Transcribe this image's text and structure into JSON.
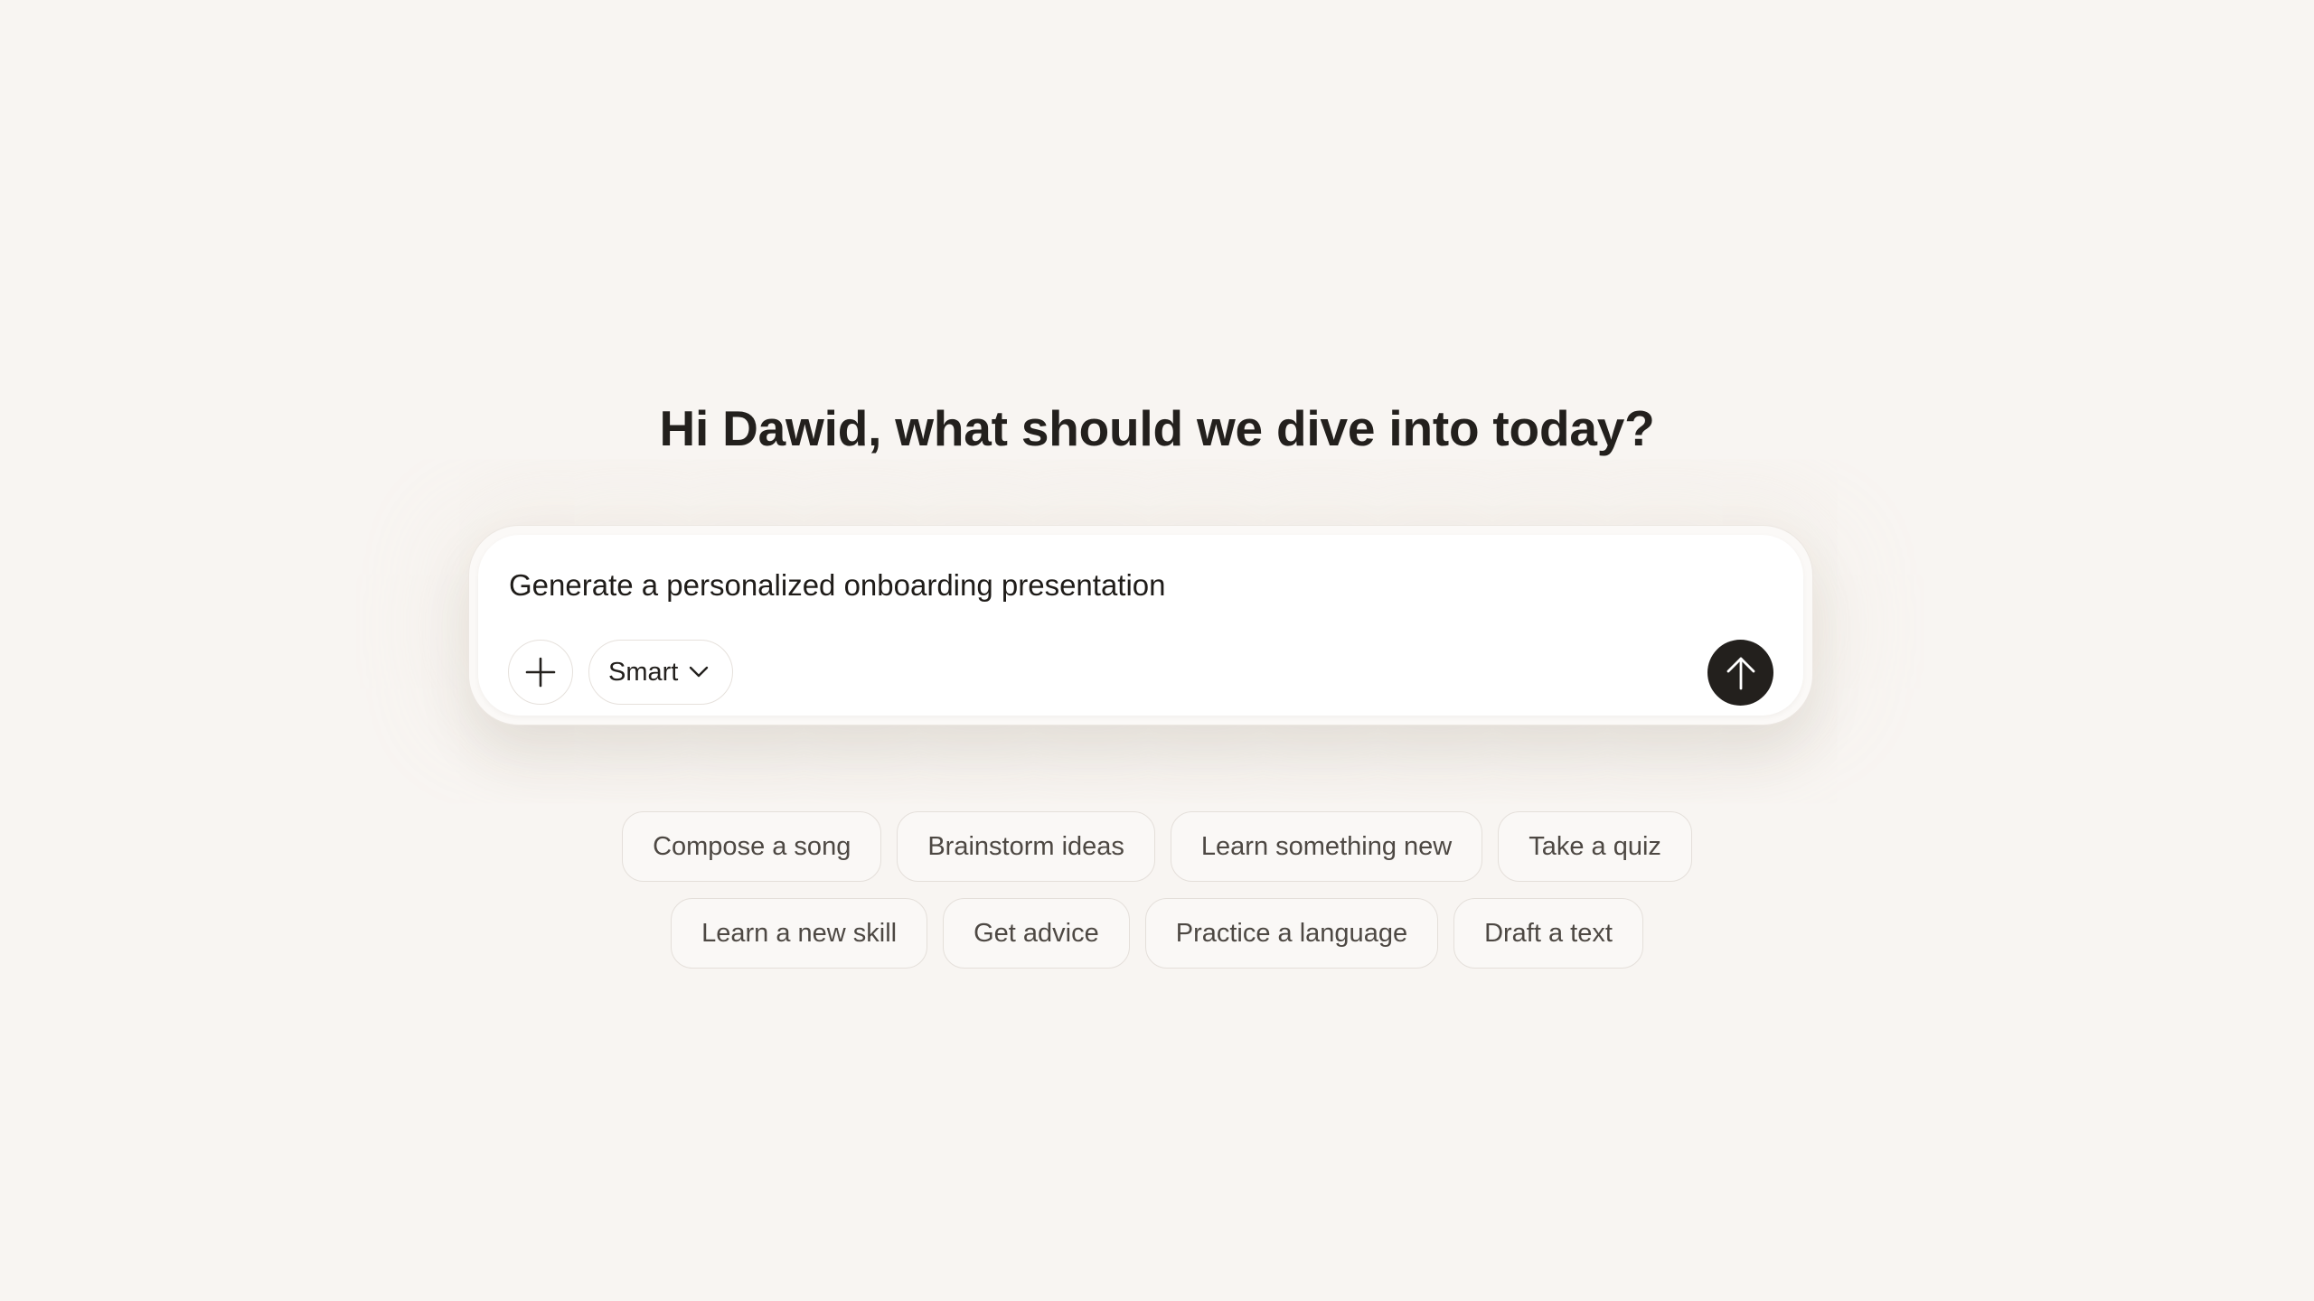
{
  "greeting": "Hi Dawid, what should we dive into today?",
  "composer": {
    "input_value": "Generate a personalized onboarding presentation",
    "model_label": "Smart",
    "icons": {
      "add": "plus-icon",
      "dropdown": "chevron-down-icon",
      "send": "arrow-up-icon"
    }
  },
  "suggestions": {
    "row1": [
      "Compose a song",
      "Brainstorm ideas",
      "Learn something new",
      "Take a quiz"
    ],
    "row2": [
      "Learn a new skill",
      "Get advice",
      "Practice a language",
      "Draft a text"
    ]
  },
  "colors": {
    "background": "#f8f5f2",
    "text": "#23201d",
    "send_button": "#23201d",
    "chip_text": "#4d4843"
  }
}
